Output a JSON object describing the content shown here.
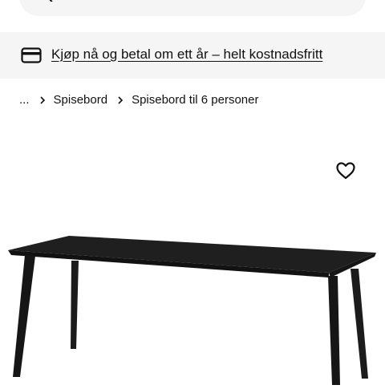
{
  "search": {
    "search_icon": "search-icon",
    "camera_icon": "camera-icon"
  },
  "promo": {
    "icon": "credit-card-icon",
    "text": "Kjøp nå og betal om ett år – helt kostnadsfritt"
  },
  "breadcrumb": {
    "ellipsis": "...",
    "items": [
      {
        "label": "Spisebord"
      },
      {
        "label": "Spisebord til 6 personer"
      }
    ]
  },
  "product": {
    "favorite_icon": "heart-icon",
    "image_subject": "dining-table-black",
    "table_color": "#1c1c1c"
  }
}
